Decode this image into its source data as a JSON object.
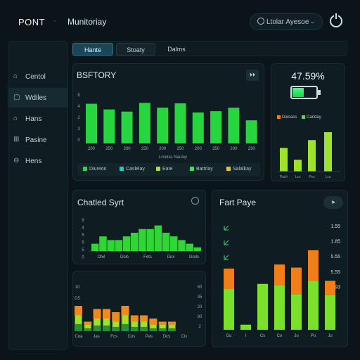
{
  "header": {
    "brand": "PONT",
    "separator": "·",
    "crumb": "Munitoriay",
    "search_label": "Ltolar Ayesoe",
    "search_chevron": "⌄"
  },
  "sidebar": {
    "items": [
      {
        "label": "Centol",
        "icon": "home-icon",
        "glyph": "⌂"
      },
      {
        "label": "Wdiles",
        "icon": "document-icon",
        "glyph": "▢"
      },
      {
        "label": "Hans",
        "icon": "tag-icon",
        "glyph": "⌂"
      },
      {
        "label": "Pasine",
        "icon": "grid-icon",
        "glyph": "⊞"
      },
      {
        "label": "Hens",
        "icon": "alert-icon",
        "glyph": "⊖"
      }
    ],
    "active_index": 1
  },
  "tabs": [
    "Hante",
    "Stoaty",
    "Dalms"
  ],
  "battery_panel": {
    "title": "BSFTORY",
    "button": "⏵⏵",
    "chart_data": {
      "type": "bar",
      "categories": [
        "200",
        "250",
        "200",
        "250",
        "200",
        "250",
        "200",
        "250",
        "200",
        "230"
      ],
      "values": [
        9.1,
        7.8,
        7.3,
        9.3,
        8.2,
        9.2,
        7.1,
        7.4,
        8.2,
        5.3
      ],
      "ylim": [
        0,
        10
      ],
      "yticks": [
        "8",
        "4",
        "2",
        "3",
        "0"
      ],
      "xlabel": "Lrnelas Naulay"
    },
    "legend": [
      {
        "label": "Diureon",
        "color": "#2bd54a"
      },
      {
        "label": "Caslelay",
        "color": "#23c7c0"
      },
      {
        "label": "Eate",
        "color": "#a8e03a"
      },
      {
        "label": "Battrlay",
        "color": "#37e55a"
      },
      {
        "label": "Salalkay",
        "color": "#e1c23b"
      }
    ]
  },
  "charge_panel": {
    "percent_text": "47.59%",
    "percent_value": 47.59,
    "legend": [
      {
        "label": "Dalsacs",
        "color": "#f07e2a"
      },
      {
        "label": "Carlday",
        "color": "#66d94a"
      }
    ],
    "chart_data": {
      "type": "bar",
      "categories": [
        "Puch",
        "Lcs",
        "Pcs",
        "Lcs"
      ],
      "values": [
        6,
        3,
        8,
        10
      ],
      "ylim": [
        0,
        10
      ]
    }
  },
  "chatted_panel": {
    "title": "Chatled Syrt",
    "chart_data": {
      "type": "bar",
      "categories": [
        "Otel",
        "Dols",
        "Fets",
        "Diol",
        "Dods"
      ],
      "yticks": [
        "8",
        "4",
        "5",
        "5",
        "5",
        "0"
      ],
      "values": [
        2,
        4,
        3,
        3,
        4,
        5,
        6,
        6,
        7,
        5,
        4,
        3,
        2,
        1
      ]
    }
  },
  "stack_panel": {
    "chart_data": {
      "type": "bar",
      "categories": [
        "Coa",
        "Jas",
        "Fcs",
        "Cos",
        "Pas",
        "Dcs",
        "Cis"
      ],
      "yticks_left": [
        "10",
        "D5",
        "4",
        "0"
      ],
      "yticks_right": [
        "80",
        "35",
        "20",
        "80",
        "2"
      ],
      "series": [
        {
          "values": [
            5,
            2,
            4,
            4,
            3,
            5,
            3,
            3,
            2,
            2,
            2
          ]
        },
        {
          "values": [
            3,
            1,
            3,
            3,
            3,
            3,
            2,
            2,
            2,
            1,
            1
          ]
        }
      ]
    }
  },
  "fart_panel": {
    "title": "Fart Paye",
    "button": "➤",
    "side_values": [
      "1.55",
      "1.85",
      "5.55",
      "5.55",
      "4.93"
    ],
    "chart_data": {
      "type": "bar",
      "categories": [
        "Gu",
        "I",
        "Cs",
        "Co",
        "Ju",
        "Pu",
        "Ju"
      ],
      "series": [
        {
          "name": "",
          "values": [
            40,
            5,
            45,
            44,
            35,
            48,
            34
          ]
        },
        {
          "name": "",
          "values": [
            20,
            0,
            0,
            20,
            26,
            30,
            14
          ]
        }
      ]
    }
  }
}
